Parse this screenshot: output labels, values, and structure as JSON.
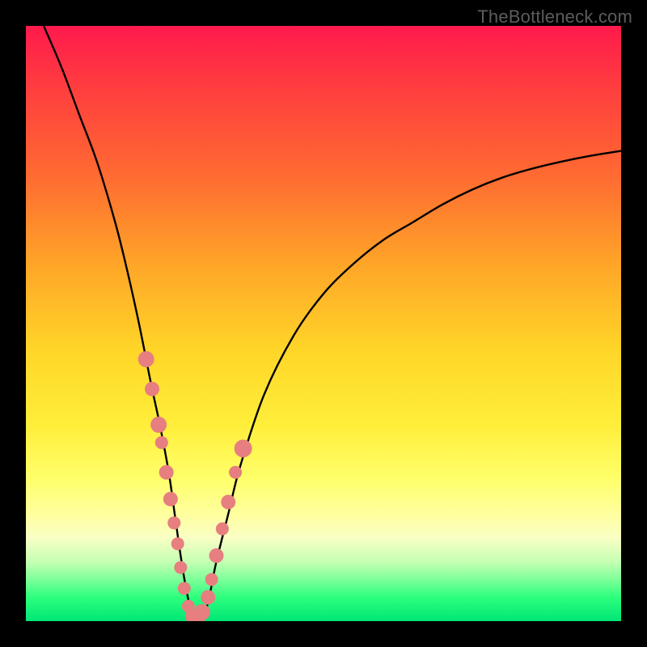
{
  "watermark": "TheBottleneck.com",
  "colors": {
    "frame": "#000000",
    "curve": "#000000",
    "dot": "#e77e80",
    "gradient_top": "#ff1a4d",
    "gradient_bottom": "#00e676"
  },
  "chart_data": {
    "type": "line",
    "title": "",
    "xlabel": "",
    "ylabel": "",
    "xlim": [
      0,
      100
    ],
    "ylim": [
      0,
      100
    ],
    "grid": false,
    "series": [
      {
        "name": "bottleneck-curve",
        "x": [
          3,
          6,
          9,
          12,
          15,
          17,
          19,
          21,
          22.5,
          24,
          25,
          26,
          27,
          28,
          29,
          30,
          31,
          32,
          34,
          36,
          40,
          45,
          50,
          55,
          60,
          65,
          70,
          75,
          80,
          85,
          90,
          95,
          100
        ],
        "y": [
          100,
          93,
          85,
          77,
          67,
          59,
          50,
          40,
          33,
          25,
          18,
          11,
          5,
          1,
          0,
          1,
          5,
          10,
          18,
          26,
          38,
          48,
          55,
          60,
          64,
          67,
          70,
          72.5,
          74.5,
          76,
          77.2,
          78.2,
          79
        ]
      }
    ],
    "points": {
      "name": "highlighted-dots",
      "x": [
        20.2,
        21.2,
        22.3,
        22.8,
        23.6,
        24.3,
        24.9,
        25.5,
        26.0,
        26.6,
        27.3,
        28.0,
        28.8,
        29.6,
        30.6,
        31.2,
        32.0,
        33.0,
        34.0,
        35.2,
        36.5
      ],
      "y": [
        44.0,
        39.0,
        33.0,
        30.0,
        25.0,
        20.5,
        16.5,
        13.0,
        9.0,
        5.5,
        2.5,
        0.8,
        0.6,
        1.5,
        4.0,
        7.0,
        11.0,
        15.5,
        20.0,
        25.0,
        29.0
      ],
      "r": [
        10,
        9,
        10,
        8,
        9,
        9,
        8,
        8,
        8,
        8,
        8,
        9,
        10,
        10,
        9,
        8,
        9,
        8,
        9,
        8,
        11
      ]
    }
  }
}
